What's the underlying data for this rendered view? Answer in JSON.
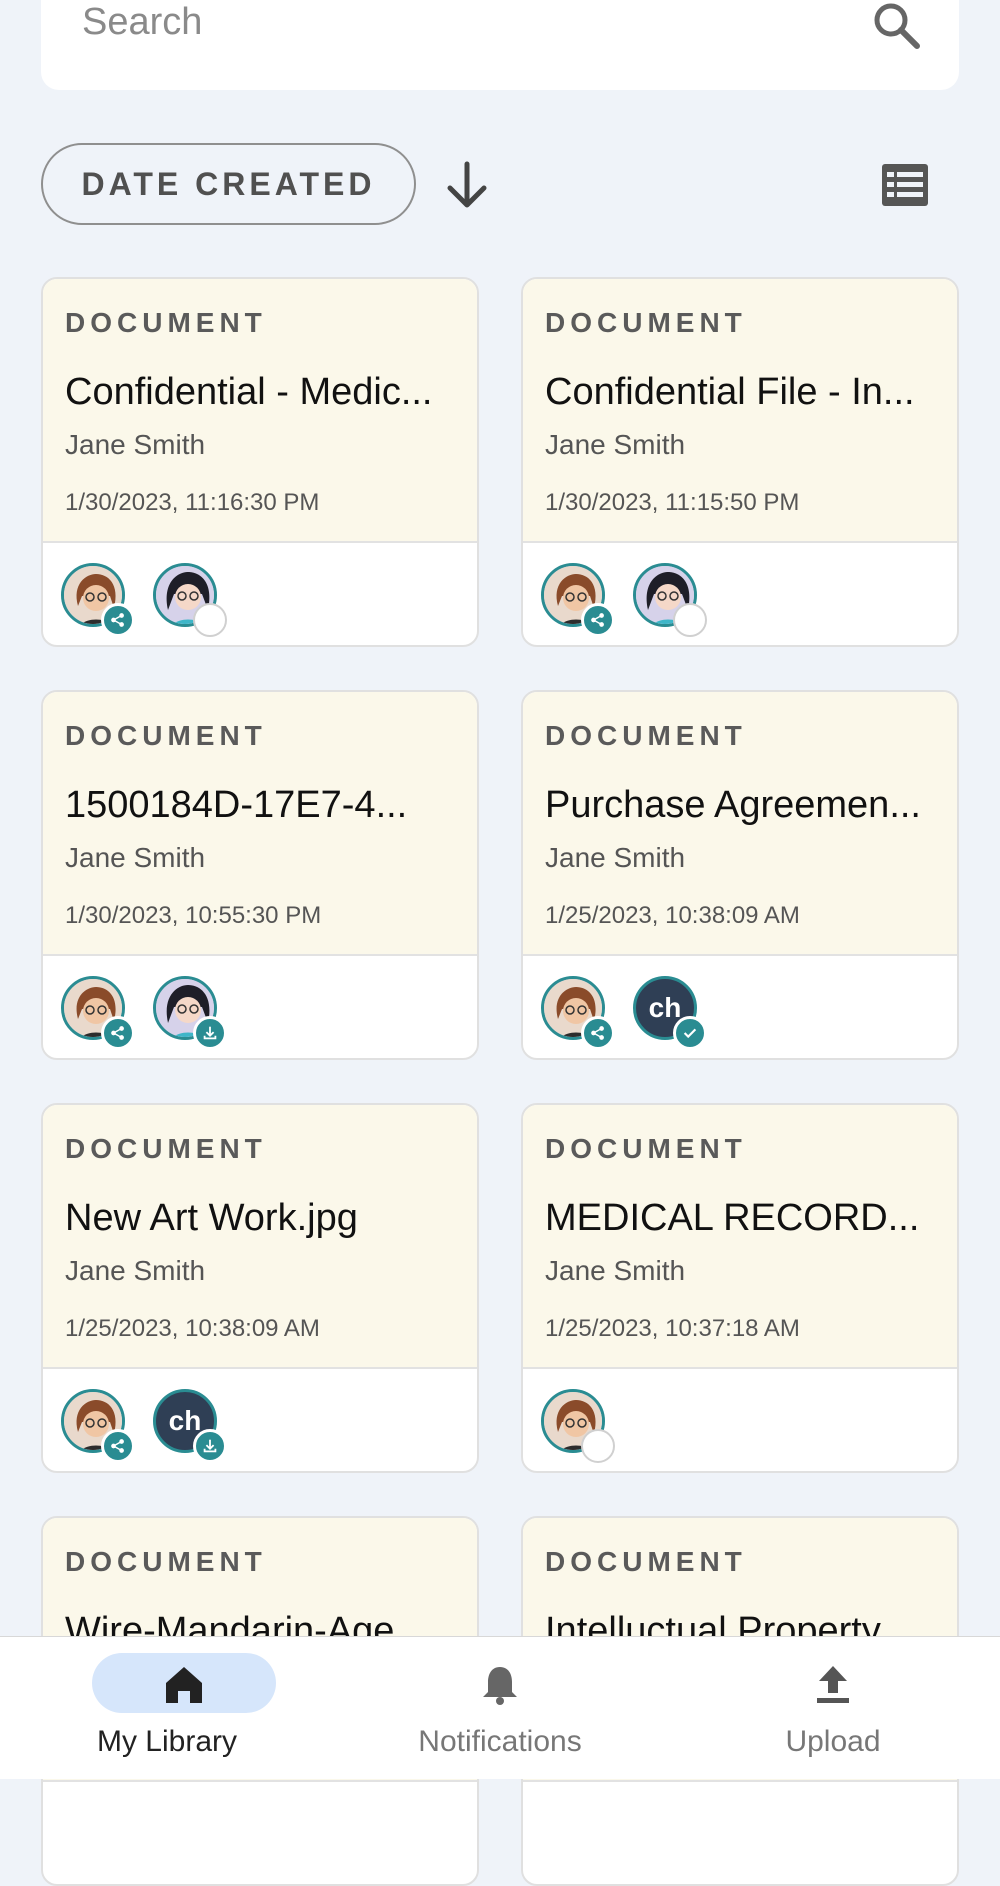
{
  "search": {
    "placeholder": "Search",
    "icon": "search-icon"
  },
  "sort": {
    "label": "DATE CREATED",
    "direction_icon": "arrow-down-icon",
    "view_icon": "list-view-icon"
  },
  "cards": [
    {
      "type": "DOCUMENT",
      "title": "Confidential - Medic...",
      "owner": "Jane Smith",
      "date": "1/30/2023, 11:16:30 PM",
      "shares": [
        {
          "avatar": "woman-glasses-avatar",
          "badge": "share"
        },
        {
          "avatar": "woman-dark-hair-avatar",
          "badge": "empty"
        }
      ]
    },
    {
      "type": "DOCUMENT",
      "title": "Confidential File - In...",
      "owner": "Jane Smith",
      "date": "1/30/2023, 11:15:50 PM",
      "shares": [
        {
          "avatar": "woman-glasses-avatar",
          "badge": "share"
        },
        {
          "avatar": "woman-dark-hair-avatar",
          "badge": "empty"
        }
      ]
    },
    {
      "type": "DOCUMENT",
      "title": "1500184D-17E7-4...",
      "owner": "Jane Smith",
      "date": "1/30/2023, 10:55:30 PM",
      "shares": [
        {
          "avatar": "woman-glasses-avatar",
          "badge": "share"
        },
        {
          "avatar": "woman-dark-hair-avatar",
          "badge": "download"
        }
      ]
    },
    {
      "type": "DOCUMENT",
      "title": "Purchase Agreemen...",
      "owner": "Jane Smith",
      "date": "1/25/2023, 10:38:09 AM",
      "shares": [
        {
          "avatar": "woman-glasses-avatar",
          "badge": "share"
        },
        {
          "avatar": "ch",
          "badge": "check"
        }
      ]
    },
    {
      "type": "DOCUMENT",
      "title": "New Art Work.jpg",
      "owner": "Jane Smith",
      "date": "1/25/2023, 10:38:09 AM",
      "shares": [
        {
          "avatar": "woman-glasses-avatar",
          "badge": "share"
        },
        {
          "avatar": "ch",
          "badge": "download"
        }
      ]
    },
    {
      "type": "DOCUMENT",
      "title": "MEDICAL RECORD...",
      "owner": "Jane Smith",
      "date": "1/25/2023, 10:37:18 AM",
      "shares": [
        {
          "avatar": "woman-glasses-avatar",
          "badge": "empty"
        }
      ]
    },
    {
      "type": "DOCUMENT",
      "title": "Wire-Mandarin-Age",
      "owner": "",
      "date": "",
      "shares": []
    },
    {
      "type": "DOCUMENT",
      "title": "Intelluctual Property",
      "owner": "",
      "date": "",
      "shares": []
    }
  ],
  "nav": [
    {
      "label": "My Library",
      "icon": "home-icon",
      "active": true
    },
    {
      "label": "Notifications",
      "icon": "bell-icon",
      "active": false
    },
    {
      "label": "Upload",
      "icon": "upload-icon",
      "active": false
    }
  ],
  "colors": {
    "accent": "#2a8c92",
    "card_top": "#fbf8ea",
    "nav_active": "#d6e6fb",
    "background": "#eff3f9"
  }
}
